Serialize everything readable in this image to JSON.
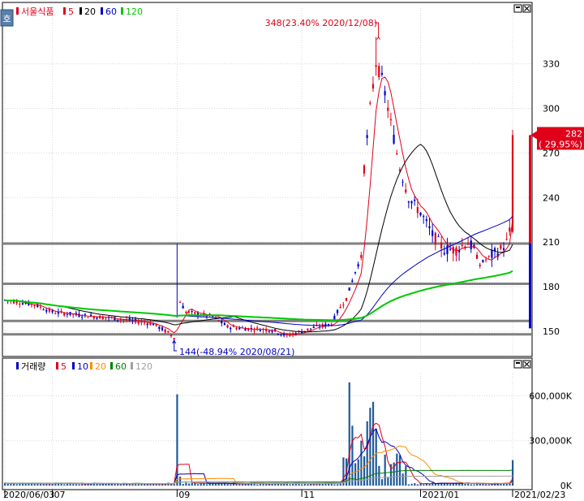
{
  "chart_data": [
    {
      "type": "candlestick",
      "title": "서울식품",
      "legend": [
        {
          "label": "5",
          "color": "#e0001a"
        },
        {
          "label": "20",
          "color": "#000000"
        },
        {
          "label": "60",
          "color": "#0000c8"
        },
        {
          "label": "120",
          "color": "#00c800"
        }
      ],
      "y_ticks": [
        330,
        300,
        270,
        240,
        210,
        180,
        150
      ],
      "ylim": [
        138,
        362
      ],
      "x_labels": [
        {
          "label": "2020/06/03",
          "idx": 0
        },
        {
          "label": "07",
          "idx": 16
        },
        {
          "label": "09",
          "idx": 58
        },
        {
          "label": "11",
          "idx": 100
        },
        {
          "label": "2021/01",
          "idx": 140
        },
        {
          "label": "2021/02/23",
          "idx": 171
        }
      ],
      "n_bars": 172,
      "horizontal_lines": [
        209,
        182,
        157,
        148
      ],
      "annotation_high": "348(23.40% 2020/12/08)",
      "annotation_low": "144(-48.94% 2020/08/21)",
      "current_price_label": "282",
      "current_change_label": "( 29.95%)",
      "current_price": 282,
      "high": 348,
      "low": 144
    },
    {
      "type": "bar",
      "title": "거래량",
      "legend": [
        {
          "label": "5",
          "color": "#e0001a"
        },
        {
          "label": "10",
          "color": "#0000c8"
        },
        {
          "label": "20",
          "color": "#ff8c00"
        },
        {
          "label": "60",
          "color": "#008000"
        },
        {
          "label": "120",
          "color": "#a0a0a0"
        }
      ],
      "y_ticks": [
        {
          "label": "600,000K",
          "value": 600000
        },
        {
          "label": "300,000K",
          "value": 300000
        },
        {
          "label": "0K",
          "value": 0
        }
      ],
      "ylim": [
        0,
        760000
      ]
    }
  ],
  "icons": {
    "corner": "호"
  }
}
